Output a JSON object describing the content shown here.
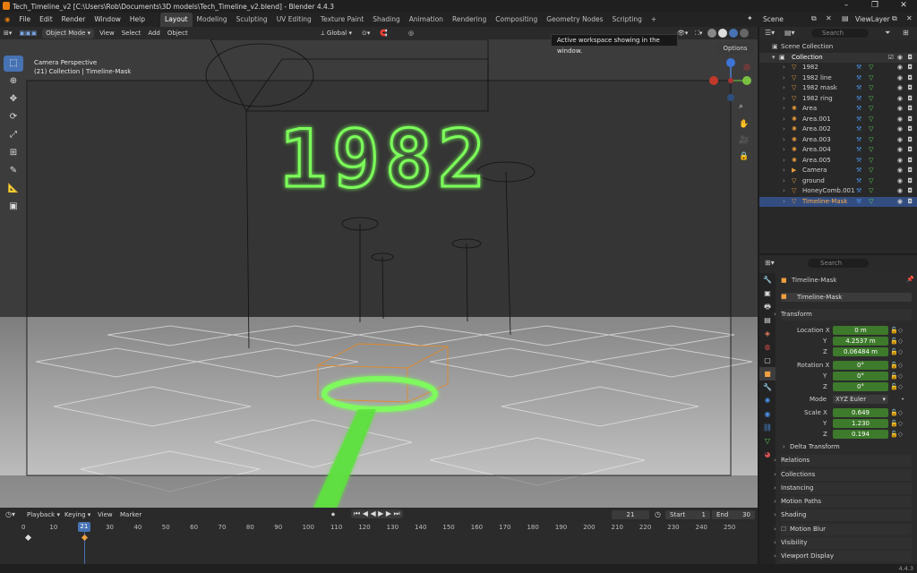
{
  "window": {
    "title": "Tech_Timeline_v2 [C:\\Users\\Rob\\Documents\\3D models\\Tech_Timeline_v2.blend] - Blender 4.4.3"
  },
  "menus": [
    "File",
    "Edit",
    "Render",
    "Window",
    "Help"
  ],
  "workspaces": [
    "Layout",
    "Modeling",
    "Sculpting",
    "UV Editing",
    "Texture Paint",
    "Shading",
    "Animation",
    "Rendering",
    "Compositing",
    "Geometry Nodes",
    "Scripting"
  ],
  "active_workspace": "Layout",
  "scene_label": "Scene",
  "viewlayer_label": "ViewLayer",
  "viewport_header": {
    "mode": "Object Mode",
    "menus": [
      "View",
      "Select",
      "Add",
      "Object"
    ],
    "transform_orientation": "Global",
    "options_label": "Options"
  },
  "viewport": {
    "perspective_label": "Camera Perspective",
    "collection_label": "(21) Collection | Timeline-Mask",
    "scene_text": "1982"
  },
  "tooltip": "Active workspace showing in the window.",
  "outliner": {
    "search_placeholder": "Search",
    "scene_collection": "Scene Collection",
    "collection": "Collection",
    "items": [
      {
        "name": "1982",
        "icon": "curve-icon"
      },
      {
        "name": "1982 line",
        "icon": "curve-icon"
      },
      {
        "name": "1982 mask",
        "icon": "curve-icon"
      },
      {
        "name": "1982 ring",
        "icon": "curve-icon"
      },
      {
        "name": "Area",
        "icon": "light-icon"
      },
      {
        "name": "Area.001",
        "icon": "light-icon"
      },
      {
        "name": "Area.002",
        "icon": "light-icon"
      },
      {
        "name": "Area.003",
        "icon": "light-icon"
      },
      {
        "name": "Area.004",
        "icon": "light-icon"
      },
      {
        "name": "Area.005",
        "icon": "light-icon"
      },
      {
        "name": "Camera",
        "icon": "camera-icon"
      },
      {
        "name": "ground",
        "icon": "mesh-icon"
      },
      {
        "name": "HoneyComb.001",
        "icon": "mesh-icon"
      },
      {
        "name": "Timeline-Mask",
        "icon": "mesh-icon",
        "selected": true
      }
    ]
  },
  "properties": {
    "search_placeholder": "Search",
    "object_name": "Timeline-Mask",
    "data_name": "Timeline-Mask",
    "transform_label": "Transform",
    "location_label": "Location X",
    "rotation_label": "Rotation X",
    "mode_label": "Mode",
    "scale_label": "Scale X",
    "axis_y": "Y",
    "axis_z": "Z",
    "location": [
      "0 m",
      "4.2537 m",
      "0.06484 m"
    ],
    "rotation": [
      "0°",
      "0°",
      "0°"
    ],
    "rotation_mode": "XYZ Euler",
    "scale": [
      "0.649",
      "1.230",
      "0.194"
    ],
    "sections": [
      "Delta Transform",
      "Relations",
      "Collections",
      "Instancing",
      "Motion Paths",
      "Shading",
      "Motion Blur",
      "Visibility",
      "Viewport Display"
    ]
  },
  "timeline": {
    "menus": [
      "Playback",
      "Keying",
      "View",
      "Marker"
    ],
    "current_frame": "21",
    "start_label": "Start",
    "start": "1",
    "end_label": "End",
    "end": "30",
    "ticks": [
      "0",
      "10",
      "20",
      "30",
      "40",
      "50",
      "60",
      "70",
      "80",
      "90",
      "100",
      "110",
      "120",
      "130",
      "140",
      "150",
      "160",
      "170",
      "180",
      "190",
      "200",
      "210",
      "220",
      "230",
      "240",
      "250"
    ]
  },
  "status": {
    "version": "4.4.3"
  },
  "colors": {
    "accent_blue": "#4772b3",
    "neon_green": "#7cff5a",
    "field_green": "#3d7a2b",
    "selection_orange": "#ffb04a"
  }
}
